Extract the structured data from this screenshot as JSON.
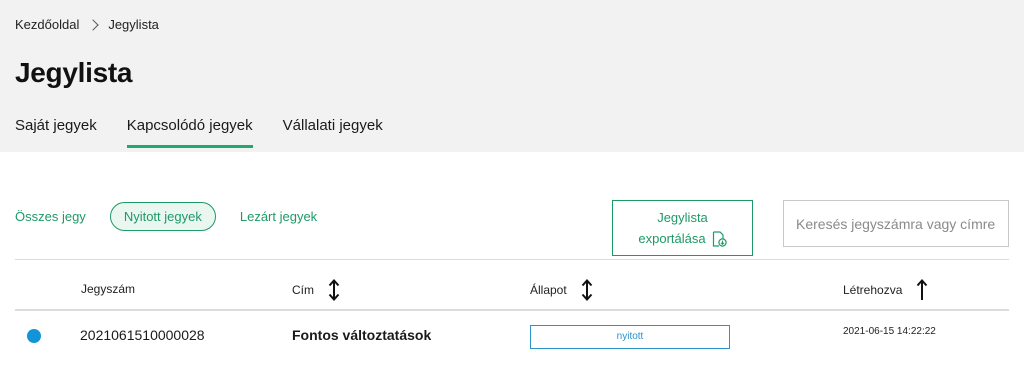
{
  "breadcrumb": {
    "home": "Kezdőoldal",
    "current": "Jegylista"
  },
  "page_title": "Jegylista",
  "tabs": [
    {
      "label": "Saját jegyek",
      "active": false
    },
    {
      "label": "Kapcsolódó jegyek",
      "active": true
    },
    {
      "label": "Vállalati jegyek",
      "active": false
    }
  ],
  "filters": {
    "all": "Összes jegy",
    "open": "Nyitott jegyek",
    "closed": "Lezárt jegyek",
    "selected": "Nyitott jegyek"
  },
  "export": {
    "line1": "Jegylista",
    "line2": "exportálása",
    "icon": "document-download-icon"
  },
  "search": {
    "placeholder": "Keresés jegyszámra vagy címre",
    "value": ""
  },
  "table": {
    "columns": {
      "number": "Jegyszám",
      "title": "Cím",
      "status": "Állapot",
      "created": "Létrehozva"
    },
    "rows": [
      {
        "indicator_color": "#1295d8",
        "number": "2021061510000028",
        "title": "Fontos változtatások",
        "status": "nyitott",
        "created": "2021-06-15 14:22:22"
      }
    ]
  },
  "colors": {
    "accent": "#1faa71",
    "status_open": "#2a93c9",
    "header_bg": "#f2f2f2"
  }
}
